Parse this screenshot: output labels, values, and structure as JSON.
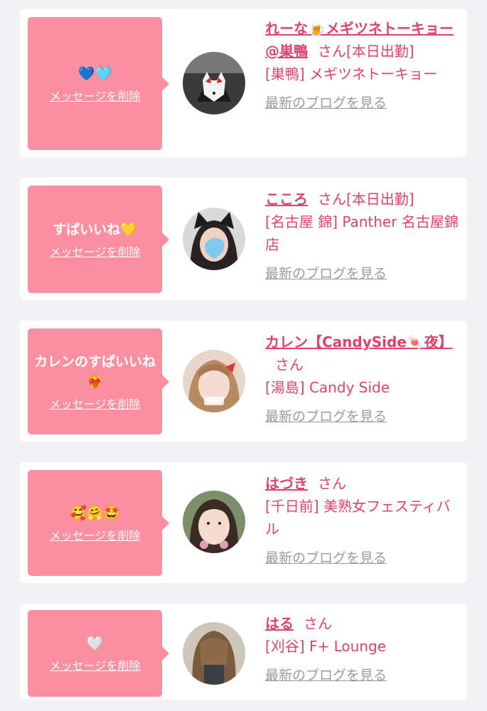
{
  "delete_label": "メッセージを削除",
  "blog_label": "最新のブログを見る",
  "san_label": "さん",
  "cards": [
    {
      "message": "💙🩵",
      "name": "れーな🍺メギツネトーキョー@巣鴨",
      "attendance": "[本日出勤]",
      "shop": "[巣鴨] メギツネトーキョー"
    },
    {
      "message": "すぱいいね💛",
      "name": "こころ",
      "attendance": "[本日出勤]",
      "shop": "[名古屋 錦] Panther 名古屋錦店"
    },
    {
      "message": "カレンのすぱいいね❤️‍🔥",
      "name": "カレン【CandySide🍬夜】",
      "attendance": "",
      "shop": "[湯島] Candy Side"
    },
    {
      "message": "🥰🤗🤩",
      "name": "はづき",
      "attendance": "",
      "shop": "[千日前] 美熟女フェスティバル"
    },
    {
      "message": "🤍",
      "name": "はる",
      "attendance": "",
      "shop": "[刈谷] F+ Lounge"
    }
  ]
}
